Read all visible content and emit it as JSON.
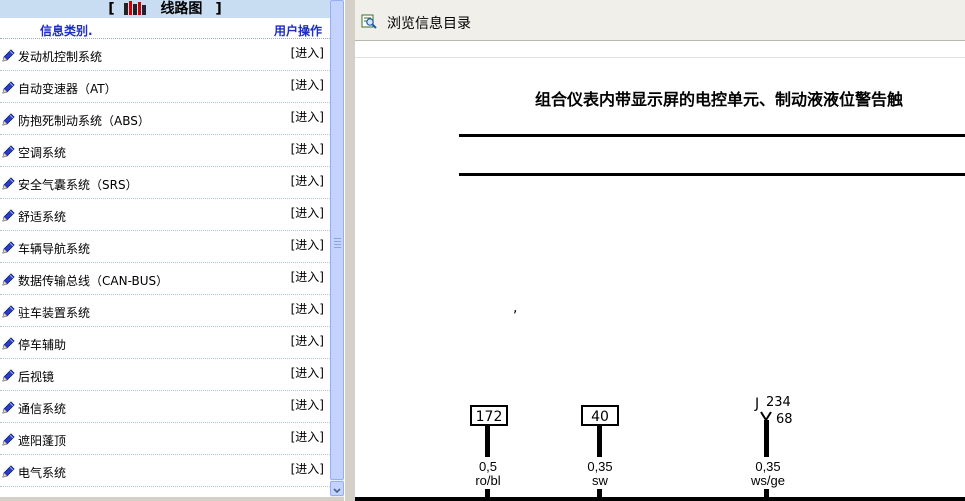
{
  "left_panel": {
    "title": "线路图",
    "title_bracket_open": "[",
    "title_bracket_close": "]",
    "col_category": "信息类别.",
    "col_action": "用户操作",
    "items": [
      {
        "label": "发动机控制系统",
        "action": "[进入]"
      },
      {
        "label": "自动变速器（AT）",
        "action": "[进入]"
      },
      {
        "label": "防抱死制动系统（ABS）",
        "action": "[进入]"
      },
      {
        "label": "空调系统",
        "action": "[进入]"
      },
      {
        "label": "安全气囊系统（SRS）",
        "action": "[进入]"
      },
      {
        "label": "舒适系统",
        "action": "[进入]"
      },
      {
        "label": "车辆导航系统",
        "action": "[进入]"
      },
      {
        "label": "数据传输总线（CAN-BUS）",
        "action": "[进入]"
      },
      {
        "label": "驻车装置系统",
        "action": "[进入]"
      },
      {
        "label": "停车辅助",
        "action": "[进入]"
      },
      {
        "label": "后视镜",
        "action": "[进入]"
      },
      {
        "label": "通信系统",
        "action": "[进入]"
      },
      {
        "label": "遮阳蓬顶",
        "action": "[进入]"
      },
      {
        "label": "电气系统",
        "action": "[进入]"
      }
    ]
  },
  "right_panel": {
    "toolbar_title": "浏览信息目录",
    "doc_title": "组合仪表内带显示屏的电控单元、制动液液位警告触",
    "mark": ",",
    "wires": [
      {
        "terminal": "172",
        "gauge": "0,5",
        "color_code": "ro/bl"
      },
      {
        "terminal": "40",
        "gauge": "0,35",
        "color_code": "sw"
      },
      {
        "component": "J",
        "component_num": "234",
        "pin": "68",
        "gauge": "0,35",
        "color_code": "ws/ge"
      }
    ]
  },
  "colors": {
    "title_bg": "#c8dcf2",
    "header_text": "#1e2ec6",
    "pen_icon": "#2a3fc0",
    "scroll_thumb": "#c3d3fd"
  }
}
